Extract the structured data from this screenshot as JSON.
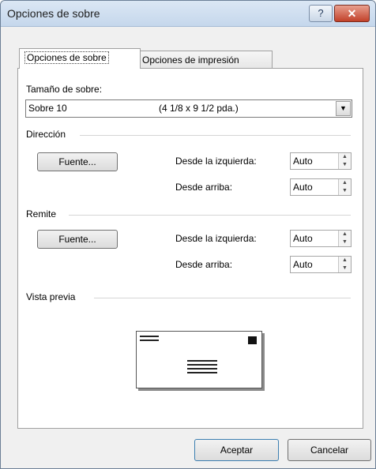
{
  "window": {
    "title": "Opciones de sobre",
    "help_label": "?",
    "close_label": "✕"
  },
  "tabs": [
    {
      "label": "Opciones de sobre",
      "active": true
    },
    {
      "label": "Opciones de impresión",
      "active": false
    }
  ],
  "envelope_size": {
    "label": "Tamaño de sobre:",
    "selected_name": "Sobre 10",
    "selected_dims": "(4 1/8 x 9 1/2 pda.)",
    "dropdown_icon": "▼"
  },
  "direccion": {
    "label": "Dirección",
    "font_button": "Fuente...",
    "from_left_label": "Desde la izquierda:",
    "from_left_value": "Auto",
    "from_top_label": "Desde arriba:",
    "from_top_value": "Auto"
  },
  "remite": {
    "label": "Remite",
    "font_button": "Fuente...",
    "from_left_label": "Desde la izquierda:",
    "from_left_value": "Auto",
    "from_top_label": "Desde arriba:",
    "from_top_value": "Auto"
  },
  "preview": {
    "label": "Vista previa"
  },
  "footer": {
    "ok": "Aceptar",
    "cancel": "Cancelar"
  },
  "spinner_icons": {
    "up": "▲",
    "down": "▼"
  },
  "colors": {
    "titlebar": "#c5d7ec",
    "close_button": "#c2412a",
    "panel": "#ffffff",
    "dialog_bg": "#f0f0f0"
  }
}
